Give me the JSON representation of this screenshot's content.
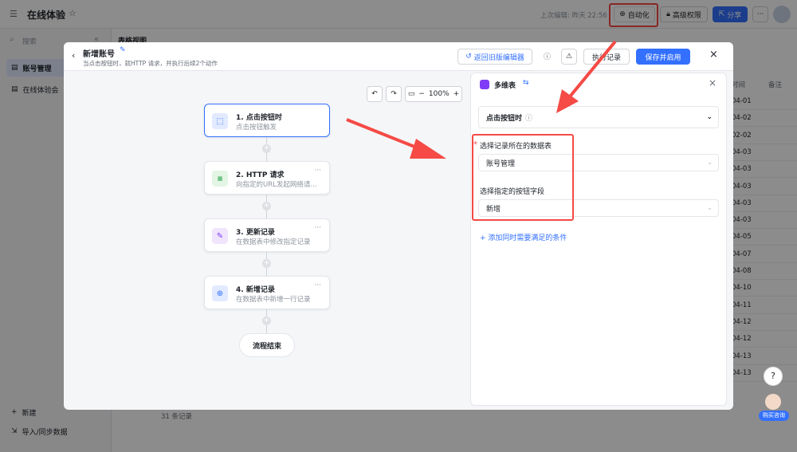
{
  "app": {
    "title": "在线体验",
    "last_edit": "上次编辑: 昨天 22:56",
    "automation_btn": "自动化",
    "permission_btn": "高级权限",
    "share_btn": "分享",
    "more": "···"
  },
  "sidebar": {
    "search_placeholder": "搜索",
    "collapse": "«",
    "items": [
      {
        "label": "账号管理"
      },
      {
        "label": "在线体验会"
      }
    ],
    "new_label": "新建",
    "import_label": "导入/同步数据"
  },
  "grid": {
    "tab_label": "表格视图",
    "col_time": "时间",
    "col_remark": "备注",
    "rows": [
      "04-01",
      "04-02",
      "02-02",
      "04-03",
      "04-03",
      "04-03",
      "04-03",
      "04-03",
      "04-05",
      "04-07",
      "04-08",
      "04-10",
      "04-11",
      "04-12",
      "04-12",
      "04-13",
      "04-13"
    ],
    "footer": "31 条记录"
  },
  "modal": {
    "title": "新增账号",
    "subtitle": "当点击按钮时，就HTTP 请求，并执行后续2个动作",
    "back_old": "返回旧版编辑器",
    "run_log": "执行记录",
    "save_enable": "保存并启用",
    "zoom": "100%",
    "nodes": [
      {
        "title": "1. 点击按钮时",
        "desc": "点击按钮触发"
      },
      {
        "title": "2. HTTP 请求",
        "desc": "向指定的URL发起网络请..."
      },
      {
        "title": "3. 更新记录",
        "desc": "在数据表中修改指定记录"
      },
      {
        "title": "4. 新增记录",
        "desc": "在数据表中新增一行记录"
      }
    ],
    "end_label": "流程结束",
    "panel": {
      "title": "多维表",
      "trigger": "点击按钮时",
      "table_label": "选择记录所在的数据表",
      "table_value": "账号管理",
      "field_label": "选择指定的按钮字段",
      "field_value": "新增",
      "add_condition": "添加同时需要满足的条件",
      "required_mark": "*"
    }
  },
  "help": {
    "label": "?",
    "consult": "购买咨询"
  },
  "colors": {
    "accent": "#3370ff",
    "arrow": "#f54a45"
  }
}
